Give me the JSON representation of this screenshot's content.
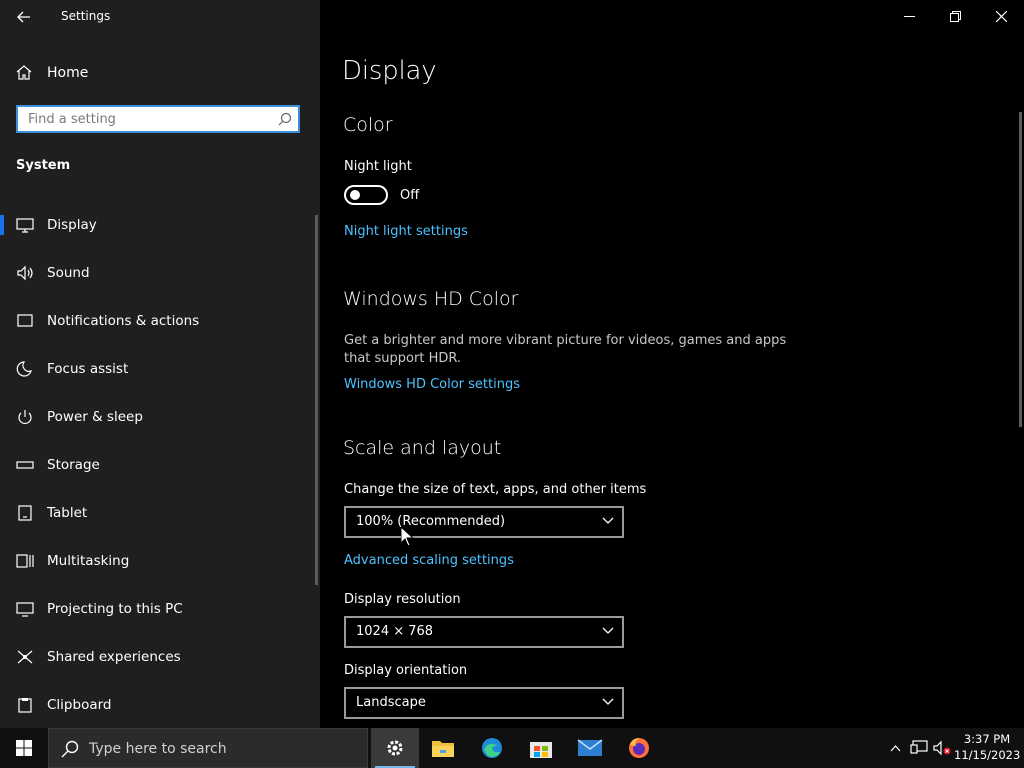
{
  "window": {
    "title": "Settings"
  },
  "sidebar": {
    "home_label": "Home",
    "search_placeholder": "Find a setting",
    "section_header": "System",
    "items": [
      {
        "label": "Display",
        "icon": "monitor-icon"
      },
      {
        "label": "Sound",
        "icon": "speaker-icon"
      },
      {
        "label": "Notifications & actions",
        "icon": "notification-icon"
      },
      {
        "label": "Focus assist",
        "icon": "moon-icon"
      },
      {
        "label": "Power & sleep",
        "icon": "power-icon"
      },
      {
        "label": "Storage",
        "icon": "storage-icon"
      },
      {
        "label": "Tablet",
        "icon": "tablet-icon"
      },
      {
        "label": "Multitasking",
        "icon": "multitasking-icon"
      },
      {
        "label": "Projecting to this PC",
        "icon": "projecting-icon"
      },
      {
        "label": "Shared experiences",
        "icon": "shared-experiences-icon"
      },
      {
        "label": "Clipboard",
        "icon": "clipboard-icon"
      }
    ],
    "active_item": "Display"
  },
  "main": {
    "page_title": "Display",
    "color": {
      "heading": "Color",
      "night_light_label": "Night light",
      "night_light_state": "Off",
      "night_light_link": "Night light settings"
    },
    "hd_color": {
      "heading": "Windows HD Color",
      "description": "Get a brighter and more vibrant picture for videos, games and apps that support HDR.",
      "link": "Windows HD Color settings"
    },
    "scale_layout": {
      "heading": "Scale and layout",
      "scale_label": "Change the size of text, apps, and other items",
      "scale_value": "100% (Recommended)",
      "advanced_link": "Advanced scaling settings",
      "resolution_label": "Display resolution",
      "resolution_value": "1024 × 768",
      "orientation_label": "Display orientation",
      "orientation_value": "Landscape"
    }
  },
  "taskbar": {
    "search_placeholder": "Type here to search",
    "time": "3:37 PM",
    "date": "11/15/2023",
    "pinned": [
      "settings-icon",
      "file-explorer-icon",
      "edge-icon",
      "store-icon",
      "mail-icon",
      "firefox-icon"
    ]
  },
  "colors": {
    "accent": "#1a73e8",
    "link": "#4cc2ff",
    "sidebar_bg": "#1f1f1f",
    "main_bg": "#000000"
  }
}
